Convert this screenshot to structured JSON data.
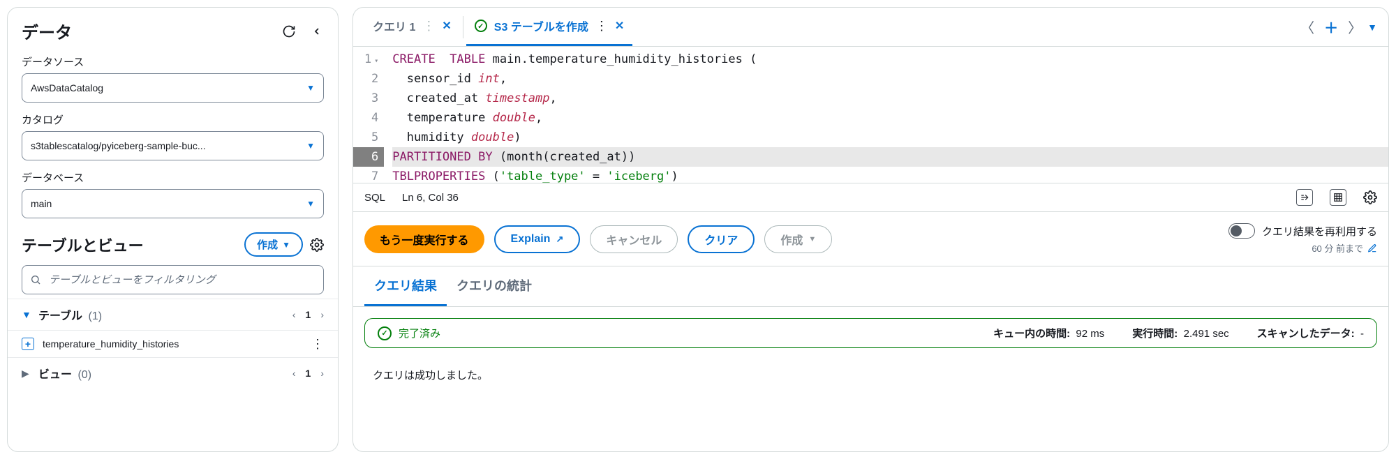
{
  "sidebar": {
    "title": "データ",
    "labels": {
      "data_source": "データソース",
      "catalog": "カタログ",
      "database": "データベース"
    },
    "selects": {
      "data_source": "AwsDataCatalog",
      "catalog": "s3tablescatalog/pyiceberg-sample-buc...",
      "database": "main"
    },
    "tables_views": {
      "heading": "テーブルとビュー",
      "create_label": "作成",
      "filter_placeholder": "テーブルとビューをフィルタリング"
    },
    "tree": {
      "tables": {
        "label": "テーブル",
        "count": "(1)",
        "page": "1"
      },
      "views": {
        "label": "ビュー",
        "count": "(0)",
        "page": "1"
      },
      "table_items": [
        "temperature_humidity_histories"
      ]
    }
  },
  "tabs": {
    "query1": "クエリ 1",
    "create_s3_table": "S3 テーブルを作成"
  },
  "editor": {
    "lines": [
      {
        "n": "1",
        "fold": true,
        "html": "<span class='kw'>CREATE</span>  <span class='kw'>TABLE</span> <span class='id'>main.temperature_humidity_histories</span> ("
      },
      {
        "n": "2",
        "html": "  <span class='id'>sensor_id</span> <span class='type'>int</span>,"
      },
      {
        "n": "3",
        "html": "  <span class='id'>created_at</span> <span class='type'>timestamp</span>,"
      },
      {
        "n": "4",
        "html": "  <span class='id'>temperature</span> <span class='type'>double</span>,"
      },
      {
        "n": "5",
        "html": "  <span class='id'>humidity</span> <span class='type'>double</span>)"
      },
      {
        "n": "6",
        "hl": true,
        "html": "<span class='kw'>PARTITIONED</span> <span class='kw'>BY</span> (<span class='fn'>month</span>(<span class='id'>created_at</span>))"
      },
      {
        "n": "7",
        "html": "<span class='kw'>TBLPROPERTIES</span> (<span class='str'>'table_type'</span> = <span class='str'>'iceberg'</span>)"
      }
    ],
    "lang": "SQL",
    "cursor": "Ln 6, Col 36"
  },
  "actions": {
    "run_again": "もう一度実行する",
    "explain": "Explain",
    "cancel": "キャンセル",
    "clear": "クリア",
    "create": "作成",
    "reuse": "クエリ結果を再利用する",
    "reuse_sub": "60 分 前まで"
  },
  "results": {
    "tab_results": "クエリ結果",
    "tab_stats": "クエリの統計",
    "status": "完了済み",
    "queue_label": "キュー内の時間:",
    "queue_value": "92 ms",
    "run_label": "実行時間:",
    "run_value": "2.491 sec",
    "scan_label": "スキャンしたデータ:",
    "scan_value": "-",
    "success_text": "クエリは成功しました。"
  }
}
